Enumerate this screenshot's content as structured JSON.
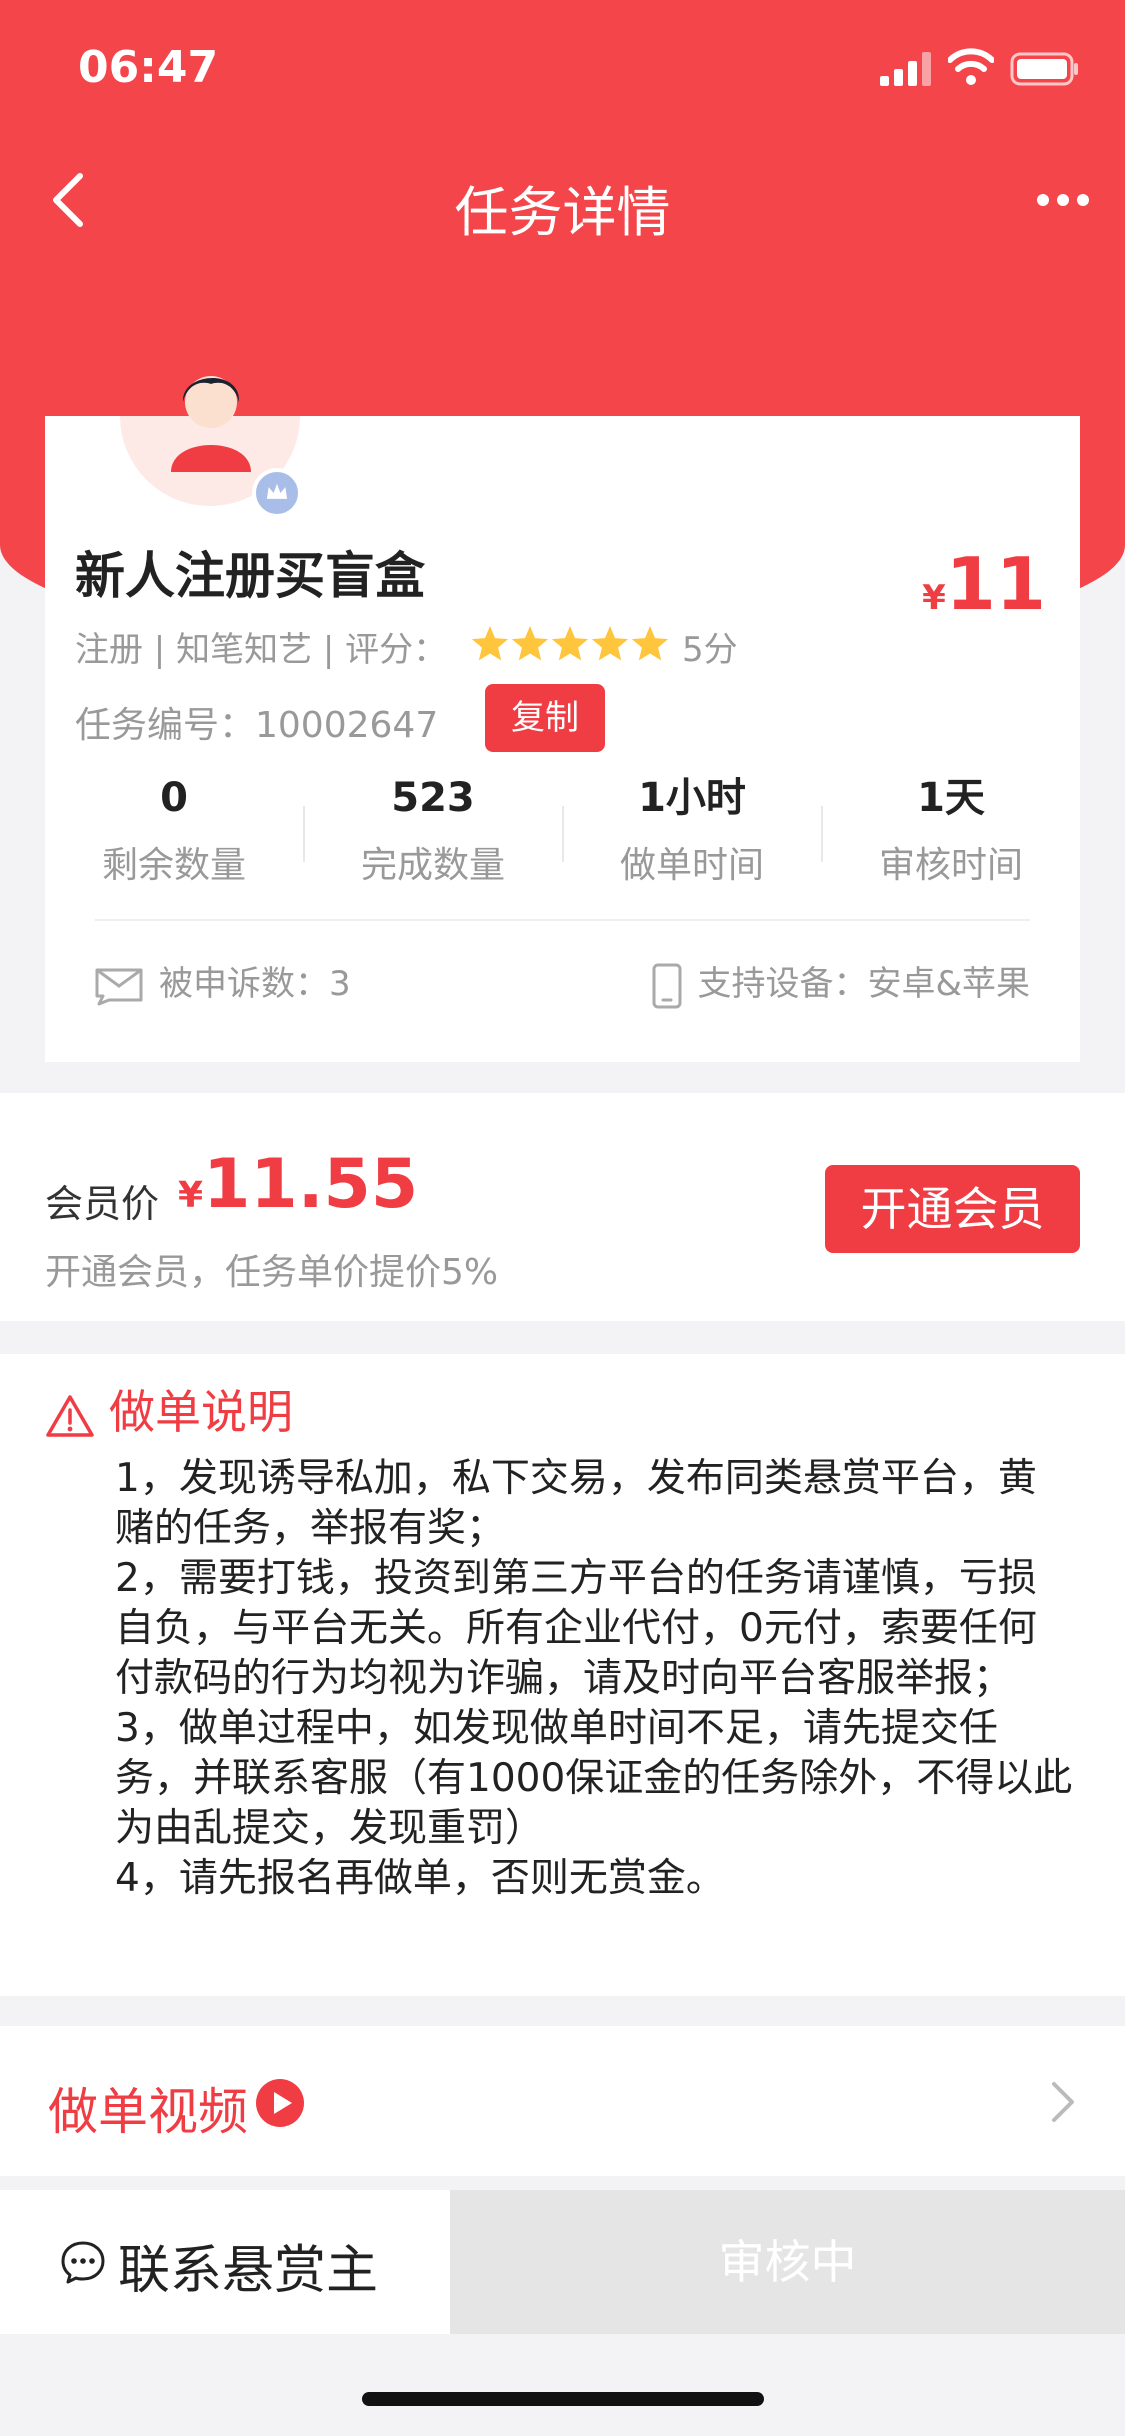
{
  "status_bar": {
    "time": "06:47"
  },
  "nav": {
    "title": "任务详情"
  },
  "task": {
    "title": "新人注册买盲盒",
    "price_currency": "¥",
    "price": "11",
    "meta": "注册 | 知笔知艺 | 评分：",
    "rating": 5,
    "rating_text": "5分",
    "task_no": "任务编号：10002647",
    "copy_label": "复制",
    "stats": [
      {
        "value": "0",
        "label": "剩余数量"
      },
      {
        "value": "523",
        "label": "完成数量"
      },
      {
        "value": "1小时",
        "label": "做单时间"
      },
      {
        "value": "1天",
        "label": "审核时间"
      }
    ],
    "complaints": "被申诉数：3",
    "devices": "支持设备：安卓&苹果"
  },
  "member": {
    "label": "会员价",
    "currency": "¥",
    "price": "11.55",
    "subtitle": "开通会员，任务单价提价5%",
    "button": "开通会员"
  },
  "instructions": {
    "title": "做单说明",
    "items": [
      "1，发现诱导私加，私下交易，发布同类悬赏平台，黄赌的任务，举报有奖；",
      "2，需要打钱，投资到第三方平台的任务请谨慎，亏损自负，与平台无关。所有企业代付，0元付，索要任何付款码的行为均视为诈骗，请及时向平台客服举报；",
      "3，做单过程中，如发现做单时间不足，请先提交任务，并联系客服（有1000保证金的任务除外，不得以此为由乱提交，发现重罚）",
      "4，请先报名再做单，否则无赏金。"
    ]
  },
  "video": {
    "label": "做单视频"
  },
  "bottom": {
    "contact": "联系悬赏主",
    "status": "审核中"
  },
  "colors": {
    "primary": "#f03c43",
    "header": "#f3454a",
    "star": "#ffc53d"
  },
  "icons": [
    "back-icon",
    "more-icon",
    "avatar-icon",
    "crown-badge-icon",
    "star-icon",
    "complaint-icon",
    "phone-icon",
    "warning-icon",
    "play-icon",
    "chevron-right-icon",
    "chat-icon"
  ]
}
